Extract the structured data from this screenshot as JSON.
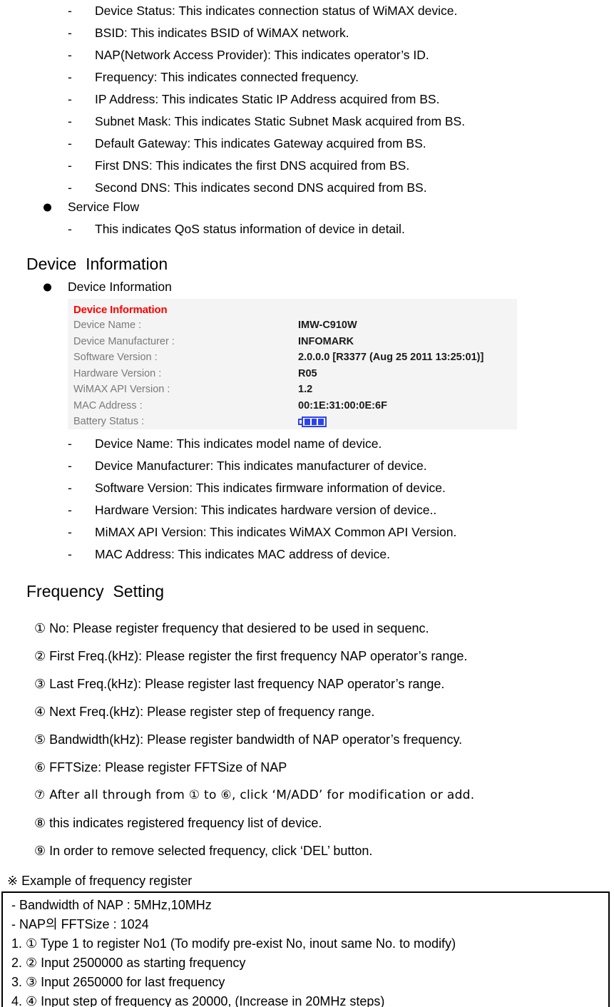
{
  "status_items": [
    "Device Status: This indicates connection status of WiMAX device.",
    "BSID: This indicates BSID of WiMAX network.",
    "NAP(Network Access Provider): This indicates operator’s ID.",
    "Frequency: This indicates connected frequency.",
    "IP Address: This indicates Static IP Address acquired from BS.",
    "Subnet Mask: This indicates Static Subnet Mask acquired from BS.",
    "Default Gateway: This indicates Gateway acquired from BS.",
    "First DNS: This indicates the first DNS acquired from BS.",
    "Second DNS: This indicates second DNS acquired from BS."
  ],
  "service_flow": {
    "bullet_label": "Service Flow",
    "detail": "This indicates QoS status information of device in detail."
  },
  "device_information": {
    "heading": "Device  Information",
    "bullet_label": "Device Information",
    "panel": {
      "title": "Device Information",
      "rows": [
        {
          "label": "Device Name :",
          "value": "IMW-C910W"
        },
        {
          "label": "Device Manufacturer :",
          "value": "INFOMARK"
        },
        {
          "label": "Software Version :",
          "value": "2.0.0.0 [R3377 (Aug 25 2011 13:25:01)]"
        },
        {
          "label": "Hardware Version :",
          "value": "R05"
        },
        {
          "label": "WiMAX API Version :",
          "value": "1.2"
        },
        {
          "label": "MAC Address :",
          "value": "00:1E:31:00:0E:6F"
        },
        {
          "label": "Battery Status :",
          "value": "",
          "icon": "battery-icon"
        }
      ],
      "title_color": "#ff0000",
      "label_color": "#7a7a7a",
      "background_color": "#f4f4f4",
      "battery_color": "#2b43ee",
      "battery_bars": 3
    },
    "items": [
      "Device Name: This indicates model name of device.",
      "Device Manufacturer: This indicates manufacturer of device.",
      "Software Version: This indicates firmware information of device.",
      "Hardware Version: This indicates hardware version of device..",
      "MiMAX API Version: This indicates WiMAX Common API Version.",
      "MAC Address: This indicates MAC address of device."
    ]
  },
  "frequency_setting": {
    "heading": "Frequency  Setting",
    "items": [
      "① No: Please register frequency that desiered to be used in sequenc.",
      "② First Freq.(kHz): Please register the first frequency NAP operator’s range.",
      "③ Last Freq.(kHz): Please register last frequency NAP operator’s range.",
      "④ Next Freq.(kHz): Please register step of frequency range.",
      "⑤ Bandwidth(kHz): Please register bandwidth of NAP operator’s frequency.",
      "⑥ FFTSize: Please register FFTSize of NAP",
      "⑦ After all through from ① to ⑥, click ‘M/ADD’ for modification or add.",
      "⑧ this indicates registered frequency list of device.",
      "⑨ In order to remove selected frequency, click ‘DEL’ button."
    ]
  },
  "example": {
    "label": "※ Example of frequency register",
    "rows": [
      "- Bandwidth of NAP : 5MHz,10MHz",
      "- NAP의  FFTSize : 1024",
      "1. ① Type 1 to register No1 (To modify pre-exist No, inout same No. to modify)",
      "2. ② Input 2500000 as starting frequency",
      "3. ③ Input 2650000 for last frequency",
      "4. ④ Input step of frequency as 20000, (Increase in 20MHz steps)"
    ]
  }
}
